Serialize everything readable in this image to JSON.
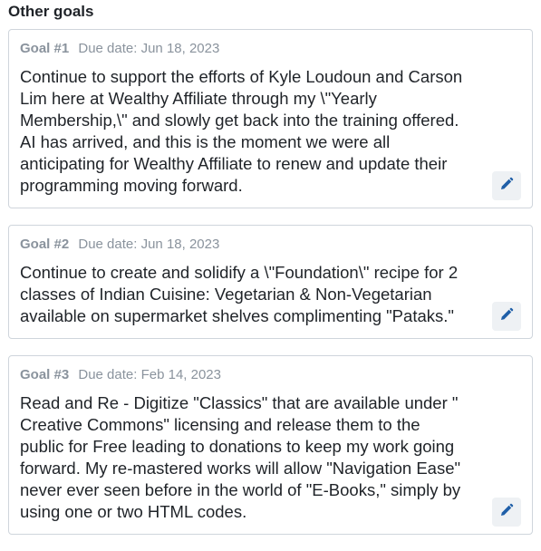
{
  "section": {
    "title": "Other goals"
  },
  "goals": [
    {
      "number": "Goal #1",
      "due": "Due date: Jun 18, 2023",
      "text": "Continue to support the efforts of Kyle Loudoun and Carson Lim here at Wealthy Affiliate through my \\\"Yearly Membership,\\\" and slowly get back into the training offered. AI has arrived, and this is the moment we were all anticipating for Wealthy Affiliate to renew and update their programming moving forward.",
      "edit_icon": "pencil-icon"
    },
    {
      "number": "Goal #2",
      "due": "Due date: Jun 18, 2023",
      "text": "Continue to create and solidify a \\\"Foundation\\\" recipe for 2 classes of Indian Cuisine: Vegetarian & Non-Vegetarian available on supermarket shelves complimenting \"Pataks.\"",
      "edit_icon": "pencil-icon"
    },
    {
      "number": "Goal #3",
      "due": "Due date: Feb 14, 2023",
      "text": "Read and Re - Digitize \"Classics\" that are available under \" Creative Commons\" licensing and release them to the public for Free leading to donations to keep my work going forward. My re-mastered works will allow \"Navigation Ease\" never ever seen before in the world of \"E-Books,\" simply by using one or two HTML codes.",
      "edit_icon": "pencil-icon"
    }
  ],
  "colors": {
    "accent": "#1f5fa8",
    "border": "#cfd5dc",
    "meta": "#8a939d"
  }
}
